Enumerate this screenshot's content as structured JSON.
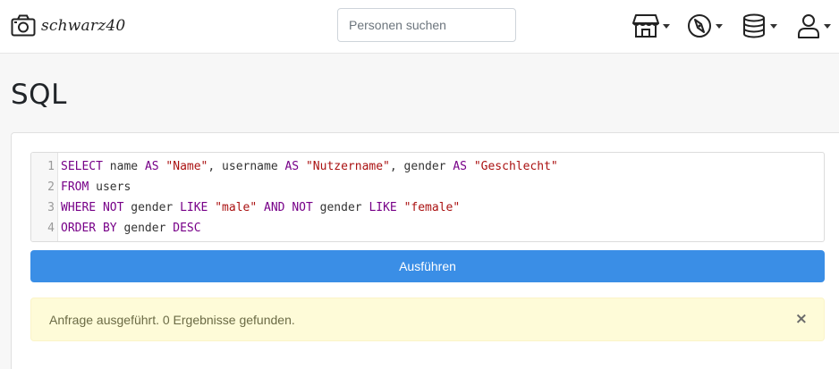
{
  "brand": {
    "name": "schwarz40",
    "icon": "camera-icon"
  },
  "search": {
    "placeholder": "Personen suchen",
    "value": ""
  },
  "nav": [
    {
      "icon": "store-icon"
    },
    {
      "icon": "compass-icon"
    },
    {
      "icon": "database-icon"
    },
    {
      "icon": "user-icon"
    }
  ],
  "page": {
    "title": "SQL"
  },
  "editor": {
    "lines": [
      {
        "num": "1",
        "tokens": [
          {
            "t": "SELECT",
            "k": "kw"
          },
          {
            "t": " name ",
            "k": ""
          },
          {
            "t": "AS",
            "k": "kw"
          },
          {
            "t": " ",
            "k": ""
          },
          {
            "t": "\"Name\"",
            "k": "str"
          },
          {
            "t": ", username ",
            "k": ""
          },
          {
            "t": "AS",
            "k": "kw"
          },
          {
            "t": " ",
            "k": ""
          },
          {
            "t": "\"Nutzername\"",
            "k": "str"
          },
          {
            "t": ", gender ",
            "k": ""
          },
          {
            "t": "AS",
            "k": "kw"
          },
          {
            "t": " ",
            "k": ""
          },
          {
            "t": "\"Geschlecht\"",
            "k": "str"
          }
        ]
      },
      {
        "num": "2",
        "tokens": [
          {
            "t": "FROM",
            "k": "kw"
          },
          {
            "t": " users",
            "k": ""
          }
        ]
      },
      {
        "num": "3",
        "tokens": [
          {
            "t": "WHERE",
            "k": "kw"
          },
          {
            "t": " ",
            "k": ""
          },
          {
            "t": "NOT",
            "k": "kw"
          },
          {
            "t": " gender ",
            "k": ""
          },
          {
            "t": "LIKE",
            "k": "kw"
          },
          {
            "t": " ",
            "k": ""
          },
          {
            "t": "\"male\"",
            "k": "str"
          },
          {
            "t": " ",
            "k": ""
          },
          {
            "t": "AND",
            "k": "kw"
          },
          {
            "t": " ",
            "k": ""
          },
          {
            "t": "NOT",
            "k": "kw"
          },
          {
            "t": " gender ",
            "k": ""
          },
          {
            "t": "LIKE",
            "k": "kw"
          },
          {
            "t": " ",
            "k": ""
          },
          {
            "t": "\"female\"",
            "k": "str"
          }
        ]
      },
      {
        "num": "4",
        "tokens": [
          {
            "t": "ORDER BY",
            "k": "kw"
          },
          {
            "t": " gender ",
            "k": ""
          },
          {
            "t": "DESC",
            "k": "kw"
          }
        ]
      }
    ]
  },
  "actions": {
    "run_label": "Ausführen"
  },
  "alert": {
    "message": "Anfrage ausgeführt. 0 Ergebnisse gefunden.",
    "close": "×"
  },
  "colors": {
    "accent": "#3a8ee6",
    "keyword": "#770088",
    "string": "#aa1111",
    "alert_bg": "#fefbd8"
  }
}
